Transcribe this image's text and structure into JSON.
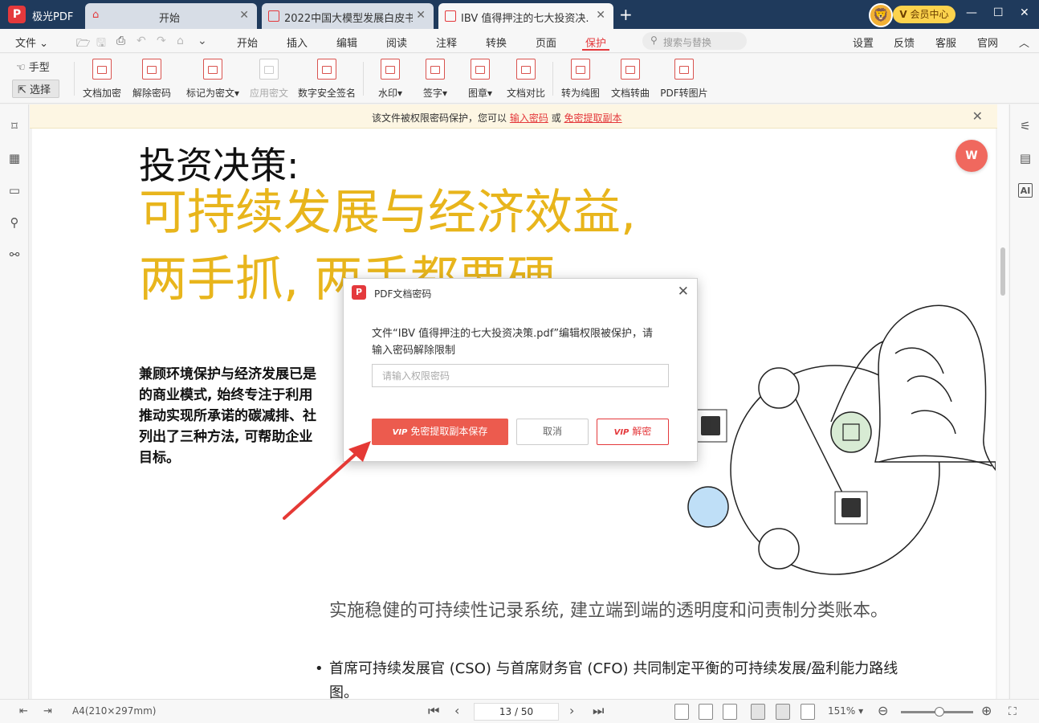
{
  "app": {
    "name": "极光PDF",
    "logo_letter": "P"
  },
  "tabs": [
    {
      "label": "开始"
    },
    {
      "label": "2022中国大模型发展白皮书..."
    },
    {
      "label": "IBV 值得押注的七大投资决..."
    }
  ],
  "vip": {
    "label": "会员中心",
    "badge": "V"
  },
  "menu": {
    "file": "文件",
    "items": [
      "开始",
      "插入",
      "编辑",
      "阅读",
      "注释",
      "转换",
      "页面",
      "保护"
    ],
    "active": "保护",
    "search_placeholder": "搜索与替换",
    "right": [
      "设置",
      "反馈",
      "客服",
      "官网"
    ]
  },
  "toolbar": {
    "hand": "手型",
    "select": "选择",
    "tools": [
      "文档加密",
      "解除密码",
      "标记为密文▾",
      "应用密文",
      "数字安全签名",
      "水印▾",
      "签字▾",
      "图章▾",
      "文档对比",
      "转为纯图",
      "文档转曲",
      "PDF转图片"
    ]
  },
  "notice": {
    "text": "该文件被权限密码保护，您可以",
    "link1": "输入密码",
    "or": "或",
    "link2": "免密提取副本"
  },
  "document": {
    "title": "投资决策:",
    "headline1": "可持续发展与经济效益,",
    "headline2": "两手抓, 两手都要硬",
    "body_lines": [
      "兼顾环境保护与经济发展已是",
      "的商业模式, 始终专注于利用",
      "推动实现所承诺的碳减排、社",
      "列出了三种方法, 可帮助企业",
      "目标。"
    ],
    "paragraph": "实施稳健的可持续性记录系统, 建立端到端的透明度和问责制分类账本。",
    "bullet": "首席可持续发展官 (CSO) 与首席财务官 (CFO) 共同制定平衡的可持续发展/盈利能力路线图。"
  },
  "dialog": {
    "title": "PDF文档密码",
    "message": "文件“IBV 值得押注的七大投资决策.pdf”编辑权限被保护，请输入密码解除限制",
    "input_placeholder": "请输入权限密码",
    "vip_tag": "VIP",
    "btn_extract": "免密提取副本保存",
    "btn_cancel": "取消",
    "btn_decrypt": "解密"
  },
  "statusbar": {
    "page_size": "A4(210×297mm)",
    "page_indicator": "13 / 50",
    "zoom": "151%"
  },
  "colors": {
    "accent": "#e4393c",
    "title_bar": "#1f3a5c",
    "headline_yellow": "#e8b51c"
  }
}
